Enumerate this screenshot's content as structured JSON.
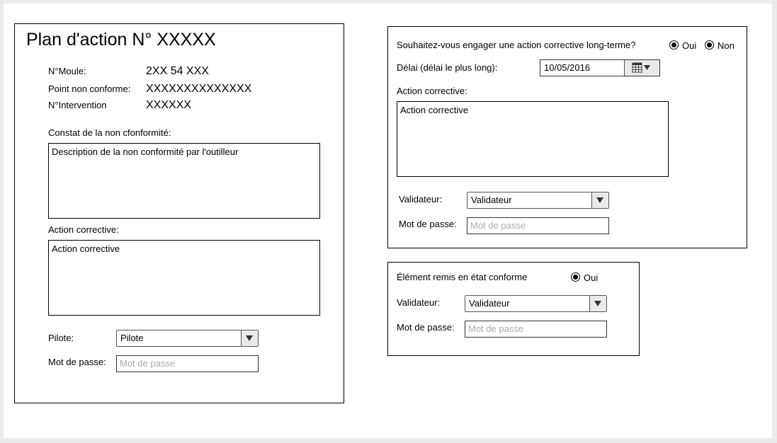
{
  "plan": {
    "title": "Plan d'action N° XXXXX",
    "moule_label": "N°Moule:",
    "moule_value": "2XX 54 XXX",
    "point_label": "Point non conforme:",
    "point_value": "XXXXXXXXXXXXXX",
    "intervention_label": "N°Intervention",
    "intervention_value": "XXXXXX",
    "constat_label": "Constat de la non cfonformité:",
    "constat_text": "Description de la non conformité par l'outilleur",
    "action_label": "Action corrective:",
    "action_text": "Action corrective",
    "pilote_label": "Pilote:",
    "pilote_value": "Pilote",
    "password_label": "Mot de passe:",
    "password_placeholder": "Mot de passe"
  },
  "long_term": {
    "question": "Souhaitez-vous engager une action corrective long-terme?",
    "oui_label": "Oui",
    "non_label": "Non",
    "delai_label": "Délai (délai le plus long):",
    "delai_value": "10/05/2016",
    "action_label": "Action corrective:",
    "action_text": "Action corrective",
    "validateur_label": "Validateur:",
    "validateur_value": "Validateur",
    "password_label": "Mot de passe:",
    "password_placeholder": "Mot de passe"
  },
  "conforme": {
    "label": "Élément remis en état conforme",
    "oui_label": "Oui",
    "validateur_label": "Validateur:",
    "validateur_value": "Validateur",
    "password_label": "Mot de passe:",
    "password_placeholder": "Mot de passe"
  },
  "icons": {
    "calendar": "calendar-icon",
    "dropdown": "chevron-down-icon"
  }
}
